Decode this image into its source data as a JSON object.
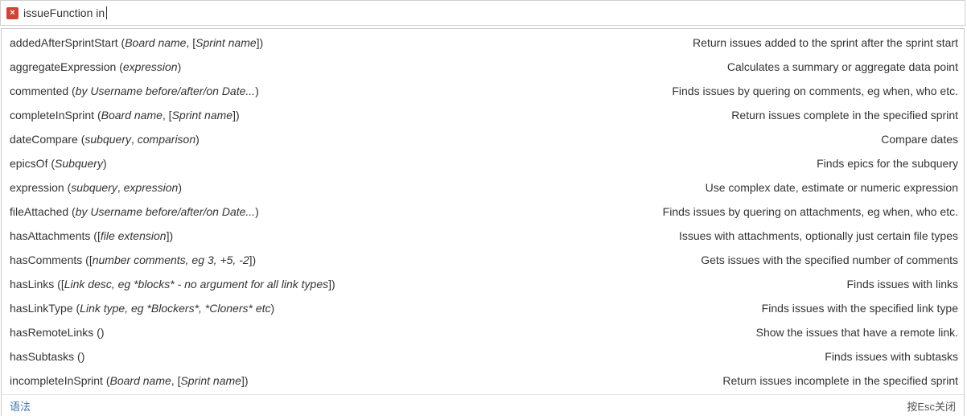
{
  "search": {
    "error_icon": "×",
    "query": "issueFunction in"
  },
  "functions": [
    {
      "name": "addedAfterSprintStart",
      "parts": [
        {
          "t": "Board name",
          "i": true
        },
        {
          "t": ", [",
          "i": false
        },
        {
          "t": "Sprint name",
          "i": true
        },
        {
          "t": "]",
          "i": false
        }
      ],
      "desc": "Return issues added to the sprint after the sprint start"
    },
    {
      "name": "aggregateExpression",
      "parts": [
        {
          "t": "expression",
          "i": true
        }
      ],
      "desc": "Calculates a summary or aggregate data point"
    },
    {
      "name": "commented",
      "parts": [
        {
          "t": "by Username before/after/on Date...",
          "i": true
        }
      ],
      "desc": "Finds issues by quering on comments, eg when, who etc."
    },
    {
      "name": "completeInSprint",
      "parts": [
        {
          "t": "Board name",
          "i": true
        },
        {
          "t": ", [",
          "i": false
        },
        {
          "t": "Sprint name",
          "i": true
        },
        {
          "t": "]",
          "i": false
        }
      ],
      "desc": "Return issues complete in the specified sprint"
    },
    {
      "name": "dateCompare",
      "parts": [
        {
          "t": "subquery",
          "i": true
        },
        {
          "t": ", ",
          "i": false
        },
        {
          "t": "comparison",
          "i": true
        }
      ],
      "desc": "Compare dates"
    },
    {
      "name": "epicsOf",
      "parts": [
        {
          "t": "Subquery",
          "i": true
        }
      ],
      "desc": "Finds epics for the subquery"
    },
    {
      "name": "expression",
      "parts": [
        {
          "t": "subquery",
          "i": true
        },
        {
          "t": ", ",
          "i": false
        },
        {
          "t": "expression",
          "i": true
        }
      ],
      "desc": "Use complex date, estimate or numeric expression"
    },
    {
      "name": "fileAttached",
      "parts": [
        {
          "t": "by Username before/after/on Date...",
          "i": true
        }
      ],
      "desc": "Finds issues by quering on attachments, eg when, who etc."
    },
    {
      "name": "hasAttachments",
      "parts": [
        {
          "t": "[",
          "i": false
        },
        {
          "t": "file extension",
          "i": true
        },
        {
          "t": "]",
          "i": false
        }
      ],
      "desc": "Issues with attachments, optionally just certain file types"
    },
    {
      "name": "hasComments",
      "parts": [
        {
          "t": "[",
          "i": false
        },
        {
          "t": "number comments, eg 3, +5, -2",
          "i": true
        },
        {
          "t": "]",
          "i": false
        }
      ],
      "desc": "Gets issues with the specified number of comments"
    },
    {
      "name": "hasLinks",
      "parts": [
        {
          "t": "[",
          "i": false
        },
        {
          "t": "Link desc, eg *blocks* - no argument for all link types",
          "i": true
        },
        {
          "t": "]",
          "i": false
        }
      ],
      "desc": "Finds issues with links"
    },
    {
      "name": "hasLinkType",
      "parts": [
        {
          "t": "Link type, eg *Blockers*, *Cloners* etc",
          "i": true
        }
      ],
      "desc": "Finds issues with the specified link type"
    },
    {
      "name": "hasRemoteLinks",
      "parts": [],
      "desc": "Show the issues that have a remote link."
    },
    {
      "name": "hasSubtasks",
      "parts": [],
      "desc": "Finds issues with subtasks"
    },
    {
      "name": "incompleteInSprint",
      "parts": [
        {
          "t": "Board name",
          "i": true
        },
        {
          "t": ", [",
          "i": false
        },
        {
          "t": "Sprint name",
          "i": true
        },
        {
          "t": "]",
          "i": false
        }
      ],
      "desc": "Return issues incomplete in the specified sprint"
    }
  ],
  "footer": {
    "syntax_link": "语法",
    "esc_hint": "按Esc关闭"
  },
  "colors": {
    "error": "#d04437",
    "link": "#3b73af"
  }
}
